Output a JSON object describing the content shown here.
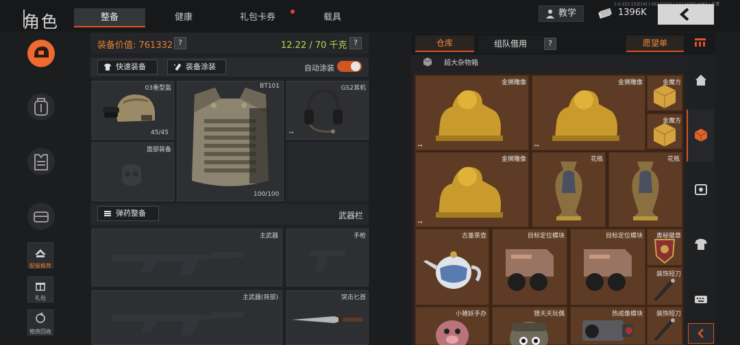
{
  "header": {
    "title": "角色",
    "tabs": [
      {
        "label": "整备"
      },
      {
        "label": "健康"
      },
      {
        "label": "礼包卡券"
      },
      {
        "label": "载具"
      }
    ],
    "teach_label": "教学",
    "money": "1396K",
    "version": "1.0.152.152[14] | 02241507 | 111163914063 | 比青"
  },
  "left_nav": {
    "items": [
      {
        "icon": "helmet-icon"
      },
      {
        "icon": "backpack-icon"
      },
      {
        "icon": "armor-icon"
      },
      {
        "icon": "chest-icon"
      }
    ],
    "small": [
      {
        "label": "配装推荐",
        "icon": "loadout-icon"
      },
      {
        "label": "礼包",
        "icon": "gift-icon"
      },
      {
        "label": "物资回收",
        "icon": "recycle-icon"
      }
    ]
  },
  "loadout": {
    "value_label": "装备价值: 761332",
    "weight": "12.22 / 70 千克",
    "help": "?",
    "quick_label": "快速装备",
    "paint_label": "装备涂装",
    "auto_paint_label": "自动涂装",
    "auto_paint_on": true,
    "slots": {
      "helmet": {
        "label": "03重型盔",
        "count": "45/45"
      },
      "face": {
        "label": "面部装备"
      },
      "armor": {
        "label": "BT101",
        "count": "100/100"
      },
      "headset": {
        "label": "GS2耳机"
      }
    },
    "ammo_label": "弹药整备",
    "weapon_bar_label": "武器栏",
    "weapons": {
      "primary": "主武器",
      "pistol": "手枪",
      "primary_back": "主武器(背部)",
      "knife": "突击匕首"
    }
  },
  "storage": {
    "stash_tab": "仓库",
    "team_tab": "组队借用",
    "wish_label": "愿望单",
    "container_label": "超大杂物箱",
    "items": [
      {
        "label": "金狮雕像"
      },
      {
        "label": "金狮雕像"
      },
      {
        "label": "金魔方"
      },
      {
        "label": "金魔方"
      },
      {
        "label": "金狮雕像"
      },
      {
        "label": "花瓶"
      },
      {
        "label": "花瓶"
      },
      {
        "label": "古董茶壶"
      },
      {
        "label": "目标定位模块"
      },
      {
        "label": "目标定位模块"
      },
      {
        "label": "奥秘徽章"
      },
      {
        "label": "装饰短刀"
      },
      {
        "label": "小猪妖手办"
      },
      {
        "label": "猎天天玩偶"
      },
      {
        "label": "热成像模块"
      },
      {
        "label": "装饰短刀"
      }
    ]
  },
  "colors": {
    "accent": "#d9541e",
    "orange_text": "#e0822f",
    "weight_green": "#bcd84e",
    "stash_bg": "#5e3b24"
  }
}
